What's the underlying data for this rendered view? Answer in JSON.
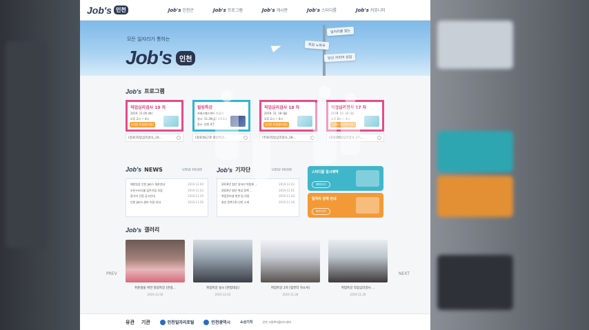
{
  "header": {
    "logo_text": "Job's",
    "logo_city": "인천",
    "nav": [
      {
        "prefix": "Job's",
        "label": "인천은"
      },
      {
        "prefix": "Job's",
        "label": "프로그램"
      },
      {
        "prefix": "Job's",
        "label": "게시판"
      },
      {
        "prefix": "Job's",
        "label": "스터디룸"
      },
      {
        "prefix": "Job's",
        "label": "커뮤니티"
      }
    ]
  },
  "hero": {
    "subtitle": "모든 일자리가 통하는",
    "title": "Job's",
    "city": "인천",
    "signs": [
      "일자리를 찾는",
      "취업 노하우",
      "당신 커리어 상담"
    ]
  },
  "program": {
    "jm": "Job's",
    "title": "프로그램",
    "cards": [
      {
        "head": "직업심리검사 19 차",
        "lines": [
          "2019. 11.00 (화)",
          "오후 2시 ~ 4시"
        ],
        "tag": "[신청] 모집중(마감)",
        "caption": "[종료]직업심리검사_19..."
      },
      {
        "head": "힐링특강",
        "lines": [
          "프레스밸스피드 만들기",
          "일시: 11.29(금) 오후3시",
          "장소: 인천 ICT"
        ],
        "tag": "",
        "caption": "[종료]퇴근로 힐링특강..."
      },
      {
        "head": "직업심리검사 18 차",
        "lines": [
          "2019. 11. 18 (월)",
          "오후 2시 ~ 4시"
        ],
        "tag": "[신청] 모집중(마감)",
        "caption": "[종료]직업심리검사_18..."
      },
      {
        "head": "직업심리검사 17 차",
        "lines": [
          "2019. 10. 28 (월)",
          "오후 2시 ~ 4시"
        ],
        "tag": "[신청] 모집중(마감)",
        "caption": "[종료]직업심리검사_17..."
      }
    ]
  },
  "news": {
    "jm": "Job's",
    "title": "NEWS",
    "more": "VIEW MORE",
    "items": [
      {
        "text": "해빙빙상 인천 Job's 개관안내",
        "date": "2019.12.04"
      },
      {
        "text": "오픈스터디룸 입주기업 모집",
        "date": "2019.12.03"
      },
      {
        "text": "참가자 선정 공고안내",
        "date": "2019.11.29"
      },
      {
        "text": "인천 Job's 센터 이용 안내",
        "date": "2019.11.26"
      }
    ]
  },
  "reporter": {
    "jm": "Job's",
    "title": "기자단",
    "more": "VIEW MORE",
    "items": [
      {
        "text": "2019년 청년 일자리 박람회 ...",
        "date": "2019.12.03"
      },
      {
        "text": "2020년 청년 취업 정책 ...",
        "date": "2019.12.01"
      },
      {
        "text": "취업준비생 위한 팁 모음",
        "date": "2019.11.30"
      },
      {
        "text": "청년 정책 [4] 인천 소개",
        "date": "2019.11.28"
      }
    ]
  },
  "promos": [
    {
      "title": "스터디룸 일시예약",
      "button": "예약하기"
    },
    {
      "title": "일자리 정책 안내",
      "button": "바로가기"
    }
  ],
  "gallery": {
    "jm": "Job's",
    "title": "갤러리",
    "items": [
      {
        "caption": "취준생을 위한 힐링특강 [관광...",
        "date": "2019.12.04"
      },
      {
        "caption": "취업특강 실시 [면접대응]",
        "date": "2019.12.02"
      },
      {
        "caption": "취업특강 2차 [컴퓨터 자소서]",
        "date": "2019.11.28"
      },
      {
        "caption": "취업특강 직업심리검사 ...",
        "date": "2019.11.26"
      }
    ],
    "prev": "PREV",
    "next": "NEXT"
  },
  "footer": {
    "title_a": "유관",
    "title_b": "기관",
    "links": [
      "인천일자리포털",
      "인천광역시",
      "소상기지",
      "인천 고용복지플러스센터"
    ]
  },
  "colors": {
    "brand_navy": "#2b3a55",
    "accent_pink": "#e64a8c",
    "accent_teal": "#2fb6cf",
    "promo_teal": "#3fb6c9",
    "promo_orange": "#f39a37"
  }
}
